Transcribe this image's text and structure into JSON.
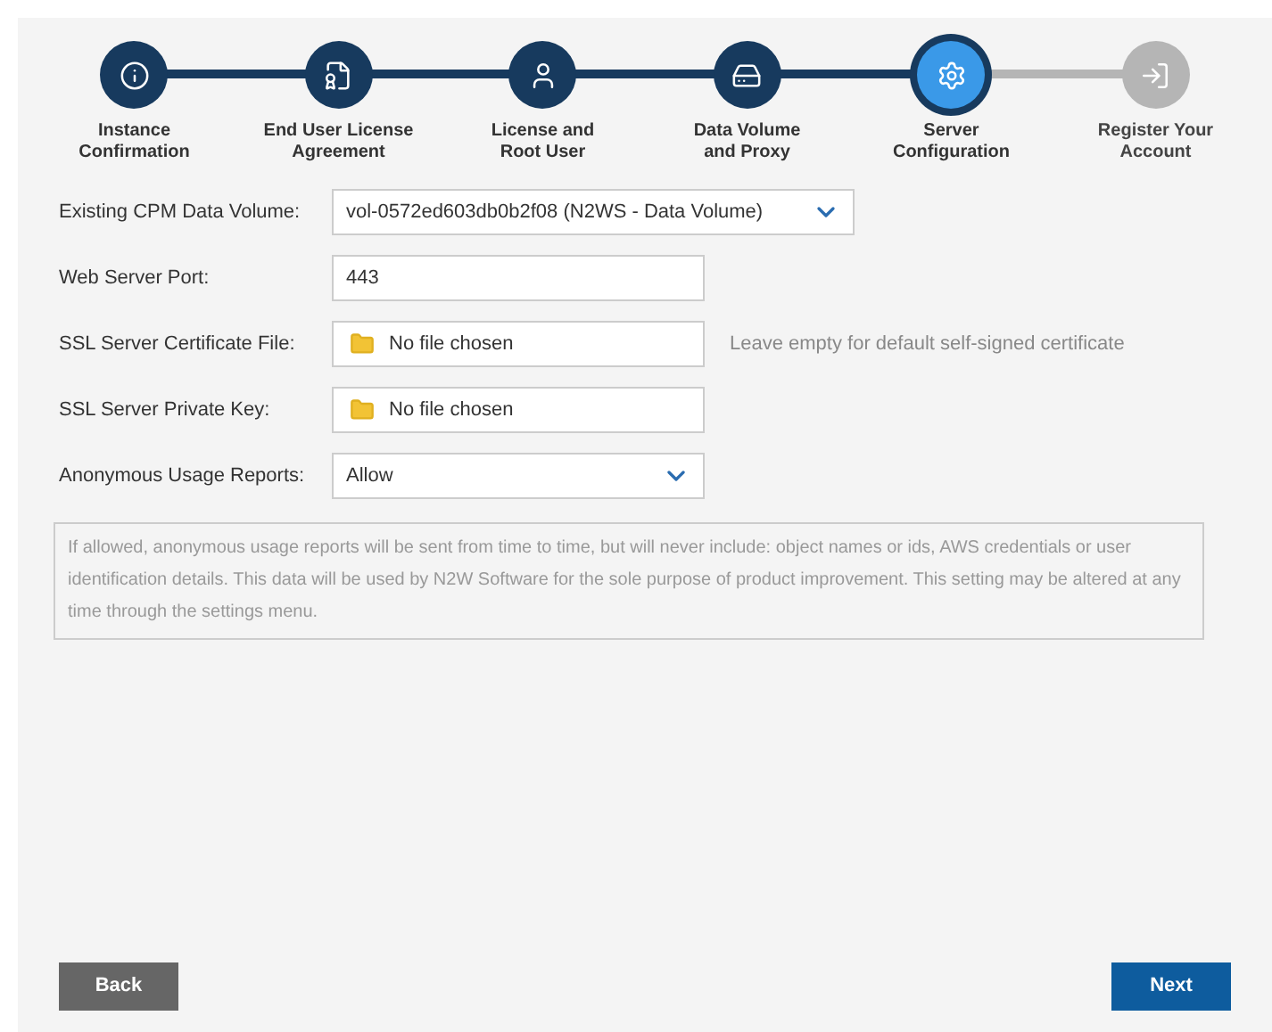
{
  "steps": [
    {
      "label_lines": [
        "Instance",
        "Confirmation"
      ],
      "completed": true,
      "selected": false
    },
    {
      "label_lines": [
        "End User License",
        "Agreement"
      ],
      "completed": true,
      "selected": false
    },
    {
      "label_lines": [
        "License and",
        "Root User"
      ],
      "completed": true,
      "selected": false
    },
    {
      "label_lines": [
        "Data Volume",
        "and Proxy"
      ],
      "completed": true,
      "selected": false
    },
    {
      "label_lines": [
        "Server",
        "Configuration"
      ],
      "completed": false,
      "selected": true
    },
    {
      "label_lines": [
        "Register Your",
        "Account"
      ],
      "completed": false,
      "selected": false
    }
  ],
  "fields": [
    {
      "label": "Existing CPM Data Volume:",
      "kind": "select",
      "value": "vol-0572ed603db0b2f08 (N2WS - Data Volume)",
      "wide": true
    },
    {
      "label": "Web Server Port:",
      "kind": "text",
      "value": "443"
    },
    {
      "label": "SSL Server Certificate File:",
      "kind": "file",
      "value": "No file chosen",
      "hint": "Leave empty for default self-signed certificate"
    },
    {
      "label": "SSL Server Private Key:",
      "kind": "file",
      "value": "No file chosen"
    },
    {
      "label": "Anonymous Usage Reports:",
      "kind": "select",
      "value": "Allow",
      "wide": false
    }
  ],
  "note": "If allowed, anonymous usage reports will be sent from time to time, but will never include: object names or ids, AWS credentials or user identification details. This data will be used by N2W Software for the sole purpose of product improvement. This setting may be altered at any time through the settings menu.",
  "buttons": {
    "back": "Back",
    "next": "Next"
  }
}
